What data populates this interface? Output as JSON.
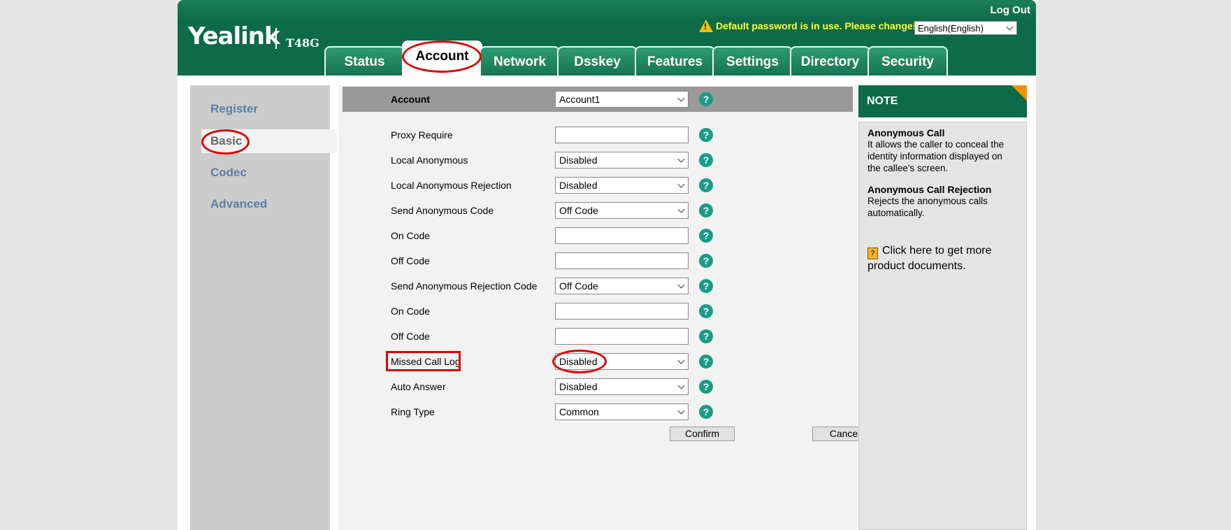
{
  "header": {
    "brand": "Yealink",
    "model": "T48G",
    "logout": "Log Out",
    "warning": "Default password is in use. Please change!",
    "language": "English(English)",
    "warning_icon": "warning-triangle-icon"
  },
  "tabs": [
    {
      "label": "Status",
      "active": false
    },
    {
      "label": "Account",
      "active": true
    },
    {
      "label": "Network",
      "active": false
    },
    {
      "label": "Dsskey",
      "active": false
    },
    {
      "label": "Features",
      "active": false
    },
    {
      "label": "Settings",
      "active": false
    },
    {
      "label": "Directory",
      "active": false
    },
    {
      "label": "Security",
      "active": false
    }
  ],
  "sidebar": {
    "items": [
      {
        "label": "Register",
        "active": false
      },
      {
        "label": "Basic",
        "active": true
      },
      {
        "label": "Codec",
        "active": false
      },
      {
        "label": "Advanced",
        "active": false
      }
    ]
  },
  "form": {
    "account": {
      "label": "Account",
      "value": "Account1"
    },
    "rows": [
      {
        "label": "Proxy Require",
        "type": "input",
        "value": ""
      },
      {
        "label": "Local Anonymous",
        "type": "select",
        "value": "Disabled"
      },
      {
        "label": "Local Anonymous Rejection",
        "type": "select",
        "value": "Disabled"
      },
      {
        "label": "Send Anonymous Code",
        "type": "select",
        "value": "Off Code"
      },
      {
        "label": "On Code",
        "type": "input",
        "value": ""
      },
      {
        "label": "Off Code",
        "type": "input",
        "value": ""
      },
      {
        "label": "Send Anonymous Rejection Code",
        "type": "select",
        "value": "Off Code"
      },
      {
        "label": "On Code",
        "type": "input",
        "value": ""
      },
      {
        "label": "Off Code",
        "type": "input",
        "value": ""
      },
      {
        "label": "Missed Call Log",
        "type": "select",
        "value": "Disabled"
      },
      {
        "label": "Auto Answer",
        "type": "select",
        "value": "Disabled"
      },
      {
        "label": "Ring Type",
        "type": "select",
        "value": "Common"
      }
    ],
    "help_symbol": "?",
    "confirm": "Confirm",
    "cancel": "Cancel"
  },
  "note": {
    "title": "NOTE",
    "sections": [
      {
        "title": "Anonymous Call",
        "text": "It allows the caller to conceal the identity information displayed on the callee’s screen."
      },
      {
        "title": "Anonymous Call Rejection",
        "text": "Rejects the anonymous calls automatically."
      }
    ],
    "doc_link": "Click here to get more product documents."
  },
  "colors": {
    "header_green": "#0d6b49",
    "annotation_red": "#e00000",
    "help_teal": "#1a9c85",
    "sidebar_link": "#5a7fa8"
  }
}
